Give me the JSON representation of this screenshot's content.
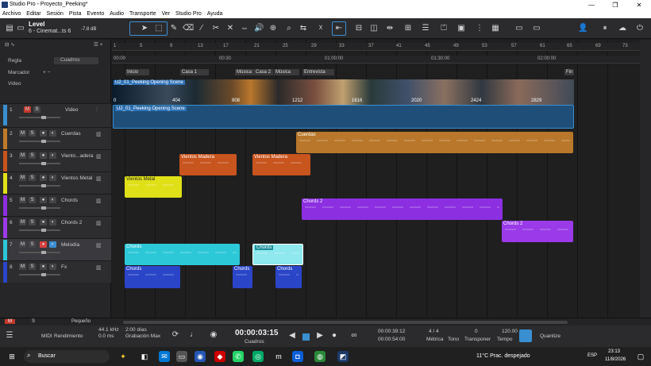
{
  "window": {
    "title": "Studio Pro - Proyecto_Peeking*",
    "controls": [
      "—",
      "❐",
      "✕"
    ]
  },
  "menu": [
    "Archivo",
    "Editar",
    "Sesión",
    "Pista",
    "Evento",
    "Audio",
    "Transporte",
    "Ver",
    "Studio Pro",
    "Ayuda"
  ],
  "song": {
    "label": "Level",
    "sub": "6 - Cinemat...ts 6",
    "volume": "-7.8 dB"
  },
  "left": {
    "regla": "Regla",
    "timebase": "Cuadros",
    "marcador": "Marcador",
    "video": "Video"
  },
  "ruler": {
    "bars": [
      "1",
      "5",
      "9",
      "13",
      "17",
      "21",
      "25",
      "29",
      "33",
      "37",
      "41",
      "45",
      "49",
      "53",
      "57",
      "61",
      "65",
      "69",
      "73"
    ],
    "times": [
      "00:00",
      "00:30",
      "01:00:00",
      "01:30:00",
      "02:00:00"
    ],
    "frames": [
      "0",
      "404",
      "808",
      "1212",
      "1616",
      "2020",
      "2424",
      "2829"
    ]
  },
  "markers": [
    "Inicio",
    "Casa 1",
    "Música",
    "Casa 2",
    "Música",
    "Entrevista",
    "Fin"
  ],
  "tracks": [
    {
      "num": "1",
      "name": "Video",
      "color": "#3a8fd0"
    },
    {
      "num": "2",
      "name": "Cuerdas",
      "color": "#c07a2a"
    },
    {
      "num": "3",
      "name": "Viento...adera",
      "color": "#c8541e"
    },
    {
      "num": "4",
      "name": "Vientos Metal",
      "color": "#e2e21a"
    },
    {
      "num": "5",
      "name": "Chords",
      "color": "#8c2fe0"
    },
    {
      "num": "6",
      "name": "Chords 2",
      "color": "#9a3ae8"
    },
    {
      "num": "7",
      "name": "Melodía",
      "color": "#2cc8d8"
    },
    {
      "num": "8",
      "name": "Fx",
      "color": "#2a45c8"
    }
  ],
  "clips": {
    "video_clip": "U2_01_Peeking Opening Scene",
    "video_audio": "U2_01_Peeking Opening Scene",
    "cuerdas": "Cuerdas",
    "viento1": "Vientos Madera",
    "viento2": "Vientos Madera",
    "metal": "Vientos Metal",
    "chords2a": "Chords 2",
    "chords2b": "Chords 2",
    "mel1": "Chords",
    "mel2": "Chords",
    "fx1": "Chords",
    "fx2": "Chords",
    "fx3": "Chords"
  },
  "status": {
    "m": "M",
    "s": "S",
    "size": "Pequeño"
  },
  "transport": {
    "rate": "44.1 kHz",
    "latency": "0.0 ms",
    "midi": "MIDI",
    "perf": "Rendimiento",
    "days": "2:00 días",
    "recmax": "Grabación Max",
    "time": "00:00:03:15",
    "timebase": "Cuadros",
    "l_time": "00:00:39:12",
    "r_time": "00:00:54:00",
    "sig": "4 / 4",
    "sig_lbl": "Métrica",
    "key_lbl": "Tono",
    "transp": "0",
    "transp_lbl": "Transponer",
    "tempo": "120.00",
    "tempo_lbl": "Tempo",
    "quantize": "Quantize"
  },
  "taskbar": {
    "search": "Buscar",
    "weather": "11°C  Prac. despejado",
    "lang": "ESP",
    "time": "23:13",
    "date": "11/8/2026"
  }
}
